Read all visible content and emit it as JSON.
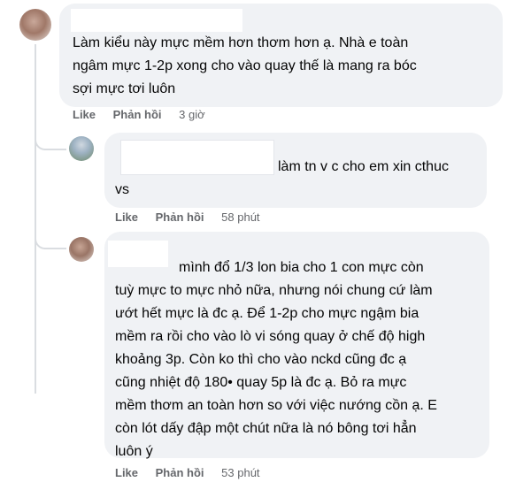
{
  "comments": [
    {
      "text": "Làm kiểu này mực mềm hơn thơm hơn ạ. Nhà e toàn\nngâm mực 1-2p xong cho vào quay thế là mang ra bóc\nsợi mực tơi luôn",
      "actions": {
        "like": "Like",
        "reply": "Phản hồi",
        "time": "3 giờ"
      }
    },
    {
      "text_first": "làm tn v c cho em xin cthuc",
      "text_rest": "vs",
      "actions": {
        "like": "Like",
        "reply": "Phản hồi",
        "time": "58 phút"
      }
    },
    {
      "text_first": "mình đổ 1/3 lon bia cho 1 con mực còn",
      "text_rest": "tuỳ mực to mực nhỏ nữa, nhưng nói chung cứ làm\nướt hết mực là đc ạ. Để 1-2p cho mực ngậm bia\nmềm ra rồi cho vào lò vi sóng quay ở chế độ high\nkhoảng 3p. Còn ko thì cho vào nckd cũng đc ạ\ncũng nhiệt độ 180• quay 5p là đc ạ. Bỏ ra mực\nmềm thơm an toàn hơn so với việc nướng cồn ạ. E\ncòn lót dấy đập một chút nữa là nó bông tơi hẳn\nluôn ý",
      "actions": {
        "like": "Like",
        "reply": "Phản hồi",
        "time": "53 phút"
      }
    }
  ]
}
